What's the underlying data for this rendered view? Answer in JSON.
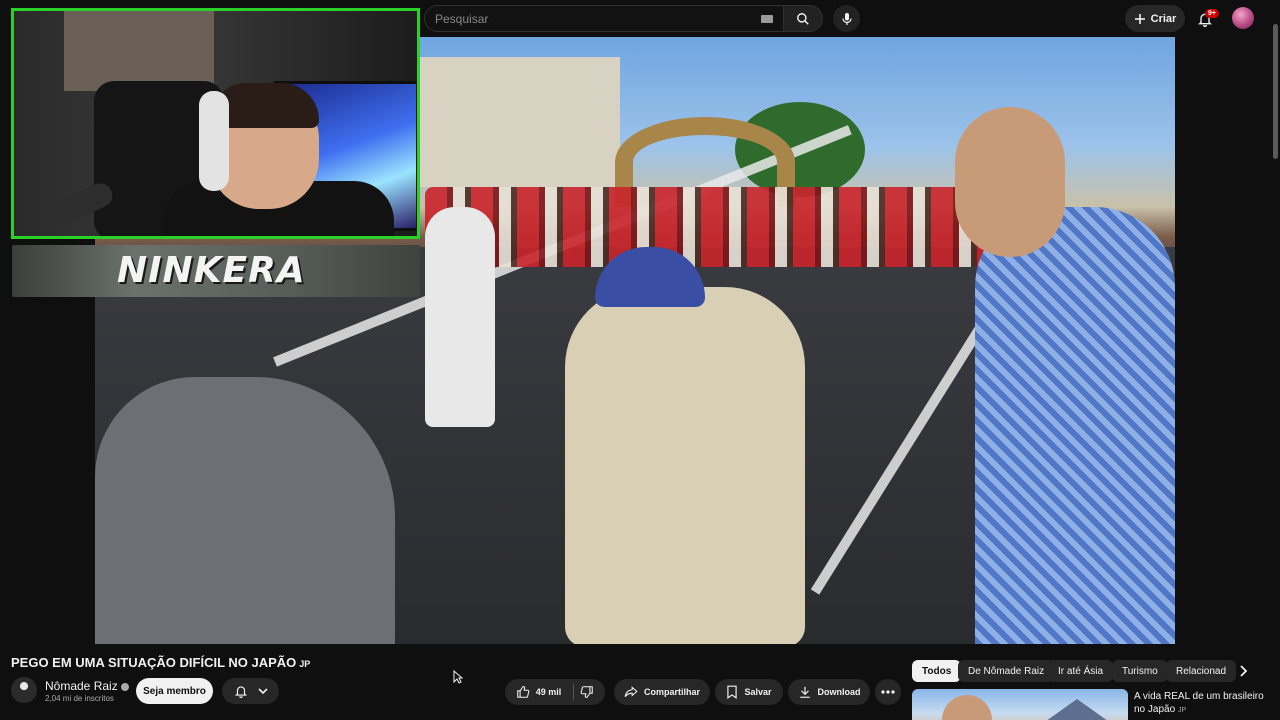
{
  "topbar": {
    "search_placeholder": "Pesquisar",
    "create_label": "Criar",
    "notification_badge": "9+"
  },
  "overlay": {
    "streamer_name": "NINKERA"
  },
  "video": {
    "title": "PEGO EM UMA SITUAÇÃO DIFÍCIL NO JAPÃO",
    "title_suffix": "JP",
    "channel_name": "Nômade Raiz",
    "subscribers": "2,04 mi de inscritos",
    "member_label": "Seja membro"
  },
  "actions": {
    "likes": "49 mil",
    "share_label": "Compartilhar",
    "save_label": "Salvar",
    "download_label": "Download"
  },
  "chips": [
    "Todos",
    "De Nômade Raiz",
    "Ir até Ásia",
    "Turismo",
    "Relacionad"
  ],
  "recommendation": {
    "title": "A vida REAL de um brasileiro no Japão",
    "title_suffix": "JP"
  },
  "colors": {
    "background": "#0f0f0f",
    "webcam_border": "#2bd12b",
    "notification_red": "#cc0000"
  }
}
